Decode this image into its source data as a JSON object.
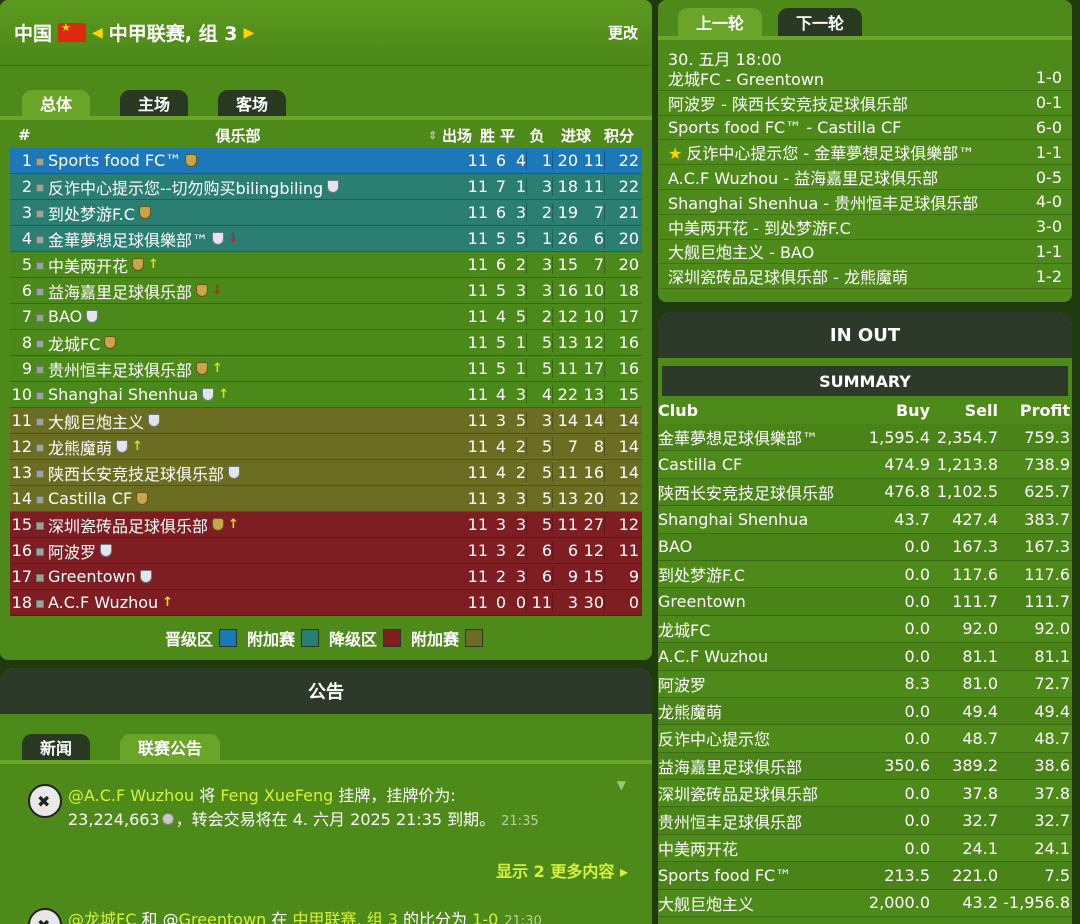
{
  "header": {
    "country": "中国",
    "league": "中甲联赛, 组 3",
    "change": "更改"
  },
  "standings_tabs": [
    "总体",
    "主场",
    "客场"
  ],
  "columns": {
    "pos": "#",
    "club": "俱乐部",
    "mp": "出场",
    "w": "胜",
    "d": "平",
    "l": "负",
    "goals": "进球",
    "pts": "积分"
  },
  "standings": [
    {
      "pos": "1",
      "club": "Sports food FC™",
      "badge": "gold",
      "trend": "",
      "zone": "promo",
      "mp": "11",
      "w": "6",
      "d": "4",
      "l": "1",
      "gf": "20",
      "ga": "11",
      "pts": "22"
    },
    {
      "pos": "2",
      "club": "反诈中心提示您--切勿购买bilingbiling",
      "badge": "silver",
      "trend": "",
      "zone": "playoff",
      "mp": "11",
      "w": "7",
      "d": "1",
      "l": "3",
      "gf": "18",
      "ga": "11",
      "pts": "22"
    },
    {
      "pos": "3",
      "club": "到处梦游F.C",
      "badge": "gold",
      "trend": "",
      "zone": "playoff",
      "mp": "11",
      "w": "6",
      "d": "3",
      "l": "2",
      "gf": "19",
      "ga": "7",
      "pts": "21"
    },
    {
      "pos": "4",
      "club": "金華夢想足球俱樂部™",
      "badge": "silver",
      "trend": "down",
      "zone": "playoff",
      "mp": "11",
      "w": "5",
      "d": "5",
      "l": "1",
      "gf": "26",
      "ga": "6",
      "pts": "20"
    },
    {
      "pos": "5",
      "club": "中美两开花",
      "badge": "gold",
      "trend": "up",
      "zone": "mid",
      "mp": "11",
      "w": "6",
      "d": "2",
      "l": "3",
      "gf": "15",
      "ga": "7",
      "pts": "20"
    },
    {
      "pos": "6",
      "club": "益海嘉里足球俱乐部",
      "badge": "gold",
      "trend": "down",
      "zone": "mid",
      "mp": "11",
      "w": "5",
      "d": "3",
      "l": "3",
      "gf": "16",
      "ga": "10",
      "pts": "18"
    },
    {
      "pos": "7",
      "club": "BAO",
      "badge": "silver",
      "trend": "",
      "zone": "mid",
      "mp": "11",
      "w": "4",
      "d": "5",
      "l": "2",
      "gf": "12",
      "ga": "10",
      "pts": "17"
    },
    {
      "pos": "8",
      "club": "龙城FC",
      "badge": "gold",
      "trend": "",
      "zone": "mid",
      "mp": "11",
      "w": "5",
      "d": "1",
      "l": "5",
      "gf": "13",
      "ga": "12",
      "pts": "16"
    },
    {
      "pos": "9",
      "club": "贵州恒丰足球俱乐部",
      "badge": "gold",
      "trend": "up",
      "zone": "mid",
      "mp": "11",
      "w": "5",
      "d": "1",
      "l": "5",
      "gf": "11",
      "ga": "17",
      "pts": "16"
    },
    {
      "pos": "10",
      "club": "Shanghai Shenhua",
      "badge": "silver",
      "trend": "up",
      "zone": "mid",
      "mp": "11",
      "w": "4",
      "d": "3",
      "l": "4",
      "gf": "22",
      "ga": "13",
      "pts": "15"
    },
    {
      "pos": "11",
      "club": "大舰巨炮主义",
      "badge": "silver",
      "trend": "",
      "zone": "relplay",
      "mp": "11",
      "w": "3",
      "d": "5",
      "l": "3",
      "gf": "14",
      "ga": "14",
      "pts": "14"
    },
    {
      "pos": "12",
      "club": "龙熊魔萌",
      "badge": "silver",
      "trend": "up",
      "zone": "relplay",
      "mp": "11",
      "w": "4",
      "d": "2",
      "l": "5",
      "gf": "7",
      "ga": "8",
      "pts": "14"
    },
    {
      "pos": "13",
      "club": "陕西长安竞技足球俱乐部",
      "badge": "silver",
      "trend": "",
      "zone": "relplay",
      "mp": "11",
      "w": "4",
      "d": "2",
      "l": "5",
      "gf": "11",
      "ga": "16",
      "pts": "14"
    },
    {
      "pos": "14",
      "club": "Castilla CF",
      "badge": "gold",
      "trend": "",
      "zone": "relplay",
      "mp": "11",
      "w": "3",
      "d": "3",
      "l": "5",
      "gf": "13",
      "ga": "20",
      "pts": "12"
    },
    {
      "pos": "15",
      "club": "深圳瓷砖品足球俱乐部",
      "badge": "gold",
      "trend": "up",
      "zone": "rel",
      "mp": "11",
      "w": "3",
      "d": "3",
      "l": "5",
      "gf": "11",
      "ga": "27",
      "pts": "12"
    },
    {
      "pos": "16",
      "club": "阿波罗",
      "badge": "silver",
      "trend": "",
      "zone": "rel",
      "mp": "11",
      "w": "3",
      "d": "2",
      "l": "6",
      "gf": "6",
      "ga": "12",
      "pts": "11"
    },
    {
      "pos": "17",
      "club": "Greentown",
      "badge": "silver",
      "trend": "",
      "zone": "rel",
      "mp": "11",
      "w": "2",
      "d": "3",
      "l": "6",
      "gf": "9",
      "ga": "15",
      "pts": "9"
    },
    {
      "pos": "18",
      "club": "A.C.F Wuzhou",
      "badge": "",
      "trend": "up",
      "zone": "rel",
      "mp": "11",
      "w": "0",
      "d": "0",
      "l": "11",
      "gf": "3",
      "ga": "30",
      "pts": "0"
    }
  ],
  "legend": [
    {
      "label": "晋级区",
      "color": "#1c78b8"
    },
    {
      "label": "附加赛",
      "color": "#2a7f72"
    },
    {
      "label": "降级区",
      "color": "#7e1e22"
    },
    {
      "label": "附加赛",
      "color": "#6b6e22"
    }
  ],
  "announcement": {
    "title": "公告",
    "tabs": [
      "新闻",
      "联赛公告"
    ],
    "item1": {
      "at": "@",
      "club": "A.C.F Wuzhou",
      "mid1": " 将 ",
      "player": "Feng XueFeng",
      "text1": " 挂牌，挂牌价为:",
      "amount": "23,224,663",
      "text2": "，转会交易将在 4. 六月 2025 21:35 到期。",
      "time": "21:35"
    },
    "more": "显示 2 更多内容",
    "item2": {
      "at1": "@",
      "club1": "龙城FC",
      "mid": " 和 @",
      "club2": "Greentown",
      "mid2": " 在 ",
      "league": "中甲联赛, 组 3",
      "text": " 的比分为 ",
      "score": "1-0",
      "time": "21:30"
    }
  },
  "results": {
    "tabs": [
      "上一轮",
      "下一轮"
    ],
    "date": "30. 五月 18:00",
    "matches": [
      {
        "teams": "龙城FC - Greentown",
        "score": "1-0",
        "star": false
      },
      {
        "teams": "阿波罗 - 陕西长安竞技足球俱乐部",
        "score": "0-1",
        "star": false
      },
      {
        "teams": "Sports food FC™ - Castilla CF",
        "score": "6-0",
        "star": false
      },
      {
        "teams": "反诈中心提示您 - 金華夢想足球俱樂部™",
        "score": "1-1",
        "star": true
      },
      {
        "teams": "A.C.F Wuzhou - 益海嘉里足球俱乐部",
        "score": "0-5",
        "star": false
      },
      {
        "teams": "Shanghai Shenhua - 贵州恒丰足球俱乐部",
        "score": "4-0",
        "star": false
      },
      {
        "teams": "中美两开花 - 到处梦游F.C",
        "score": "3-0",
        "star": false
      },
      {
        "teams": "大舰巨炮主义 - BAO",
        "score": "1-1",
        "star": false
      },
      {
        "teams": "深圳瓷砖品足球俱乐部 - 龙熊魔萌",
        "score": "1-2",
        "star": false
      }
    ]
  },
  "inout": {
    "title": "IN OUT",
    "summary": "SUMMARY",
    "headers": {
      "club": "Club",
      "buy": "Buy",
      "sell": "Sell",
      "profit": "Profit"
    },
    "rows": [
      {
        "club": "金華夢想足球俱樂部™",
        "buy": "1,595.4",
        "sell": "2,354.7",
        "profit": "759.3"
      },
      {
        "club": "Castilla CF",
        "buy": "474.9",
        "sell": "1,213.8",
        "profit": "738.9"
      },
      {
        "club": "陕西长安竞技足球俱乐部",
        "buy": "476.8",
        "sell": "1,102.5",
        "profit": "625.7"
      },
      {
        "club": "Shanghai Shenhua",
        "buy": "43.7",
        "sell": "427.4",
        "profit": "383.7"
      },
      {
        "club": "BAO",
        "buy": "0.0",
        "sell": "167.3",
        "profit": "167.3"
      },
      {
        "club": "到处梦游F.C",
        "buy": "0.0",
        "sell": "117.6",
        "profit": "117.6"
      },
      {
        "club": "Greentown",
        "buy": "0.0",
        "sell": "111.7",
        "profit": "111.7"
      },
      {
        "club": "龙城FC",
        "buy": "0.0",
        "sell": "92.0",
        "profit": "92.0"
      },
      {
        "club": "A.C.F Wuzhou",
        "buy": "0.0",
        "sell": "81.1",
        "profit": "81.1"
      },
      {
        "club": "阿波罗",
        "buy": "8.3",
        "sell": "81.0",
        "profit": "72.7"
      },
      {
        "club": "龙熊魔萌",
        "buy": "0.0",
        "sell": "49.4",
        "profit": "49.4"
      },
      {
        "club": "反诈中心提示您",
        "buy": "0.0",
        "sell": "48.7",
        "profit": "48.7"
      },
      {
        "club": "益海嘉里足球俱乐部",
        "buy": "350.6",
        "sell": "389.2",
        "profit": "38.6"
      },
      {
        "club": "深圳瓷砖品足球俱乐部",
        "buy": "0.0",
        "sell": "37.8",
        "profit": "37.8"
      },
      {
        "club": "贵州恒丰足球俱乐部",
        "buy": "0.0",
        "sell": "32.7",
        "profit": "32.7"
      },
      {
        "club": "中美两开花",
        "buy": "0.0",
        "sell": "24.1",
        "profit": "24.1"
      },
      {
        "club": "Sports food FC™",
        "buy": "213.5",
        "sell": "221.0",
        "profit": "7.5"
      },
      {
        "club": "大舰巨炮主义",
        "buy": "2,000.0",
        "sell": "43.2",
        "profit": "-1,956.8"
      }
    ]
  }
}
